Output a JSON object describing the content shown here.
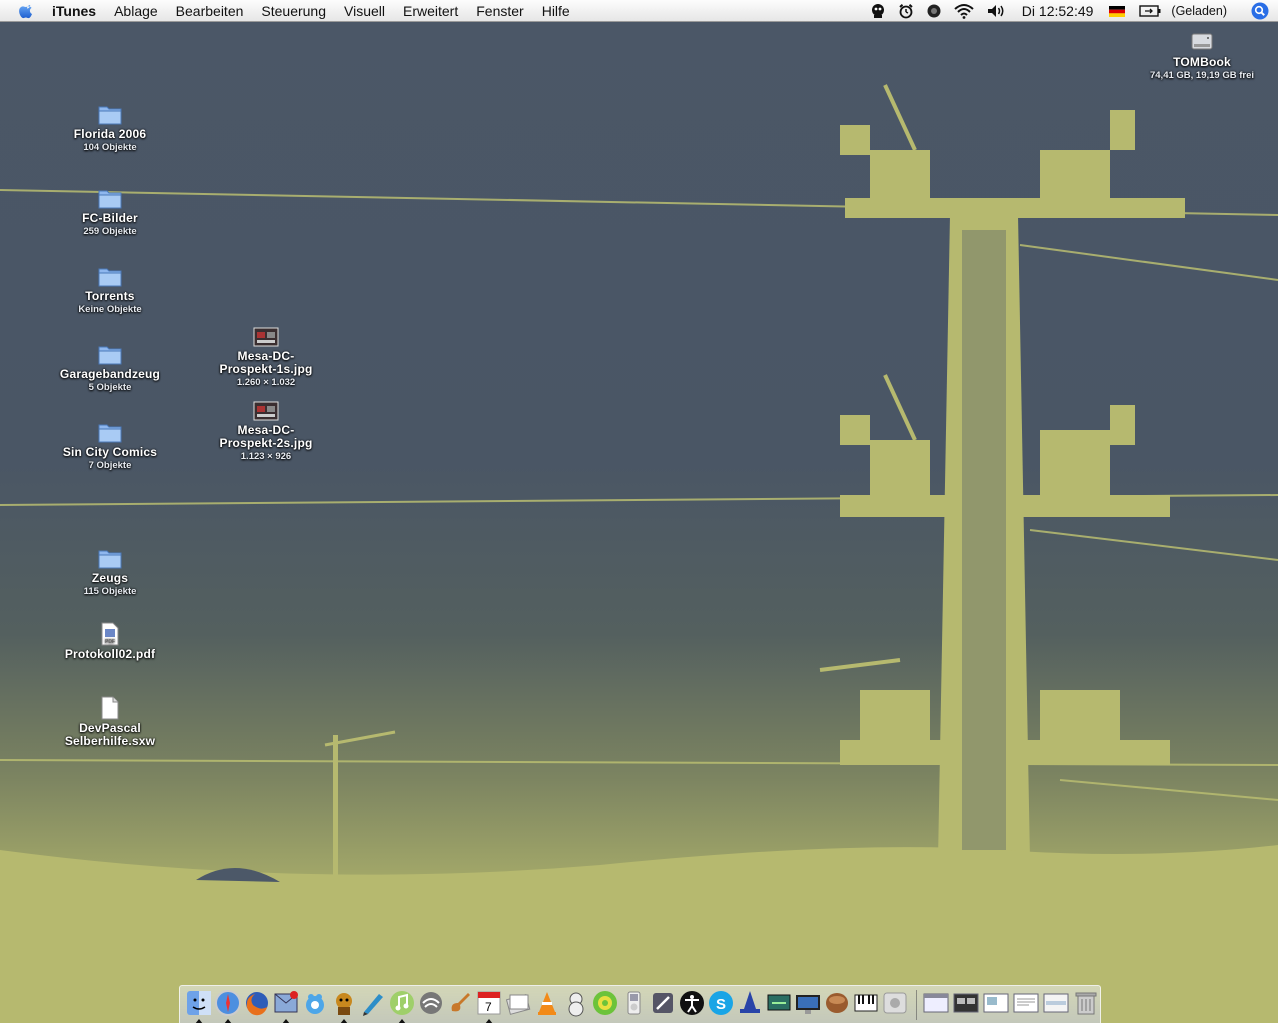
{
  "menubar": {
    "app_name": "iTunes",
    "items": [
      "Ablage",
      "Bearbeiten",
      "Steuerung",
      "Visuell",
      "Erweitert",
      "Fenster",
      "Hilfe"
    ],
    "clock": "Di 12:52:49",
    "battery_status": "(Geladen)",
    "status_icons": [
      "script-icon",
      "alarm-icon",
      "record-icon",
      "wifi-icon",
      "volume-icon",
      "german-flag-icon",
      "battery-icon",
      "spotlight-icon"
    ]
  },
  "desktop": {
    "drive": {
      "name": "TOMBook",
      "info": "74,41 GB, 19,19 GB frei"
    },
    "icons": [
      {
        "name": "Florida 2006",
        "info": "104 Objekte",
        "kind": "folder"
      },
      {
        "name": "FC-Bilder",
        "info": "259 Objekte",
        "kind": "folder"
      },
      {
        "name": "Torrents",
        "info": "Keine Objekte",
        "kind": "folder"
      },
      {
        "name": "Garagebandzeug",
        "info": "5 Objekte",
        "kind": "folder"
      },
      {
        "name": "Sin City Comics",
        "info": "7 Objekte",
        "kind": "folder"
      },
      {
        "name": "Mesa-DC-Prospekt-1s.jpg",
        "name_line1": "Mesa-DC-",
        "name_line2": "Prospekt-1s.jpg",
        "info": "1.260 × 1.032",
        "kind": "image"
      },
      {
        "name": "Mesa-DC-Prospekt-2s.jpg",
        "name_line1": "Mesa-DC-",
        "name_line2": "Prospekt-2s.jpg",
        "info": "1.123 × 926",
        "kind": "image"
      },
      {
        "name": "Zeugs",
        "info": "115 Objekte",
        "kind": "folder"
      },
      {
        "name": "Protokoll02.pdf",
        "info": "",
        "kind": "pdf"
      },
      {
        "name": "DevPascal Selberhilfe.sxw",
        "name_line1": "DevPascal",
        "name_line2": "Selberhilfe.sxw",
        "info": "",
        "kind": "document"
      }
    ]
  },
  "dock": {
    "apps": [
      "finder-icon",
      "safari-icon",
      "firefox-icon",
      "mail-icon",
      "adium-icon",
      "growl-icon",
      "pen-icon",
      "itunes-icon",
      "network-icon",
      "garageband-icon",
      "ical-icon",
      "preview-icon",
      "vlc-icon",
      "app-icon",
      "chess-icon",
      "ipod-icon",
      "pen-tool-icon",
      "accessibility-icon",
      "skype-icon",
      "wizard-icon",
      "screen-icon",
      "system-monitor-icon",
      "bowl-icon",
      "piano-icon",
      "apple-icon"
    ],
    "windows": [
      "window-1-icon",
      "window-2-icon",
      "window-3-icon",
      "window-4-icon",
      "window-5-icon",
      "trash-icon"
    ],
    "running_indicators": [
      "finder-icon",
      "safari-icon",
      "mail-icon",
      "growl-icon",
      "itunes-icon",
      "ical-icon"
    ]
  },
  "colors": {
    "sky": "#4b5767",
    "pylon": "#b6b96f",
    "menubar": "#eeeeee",
    "spotlight": "#2a6ee6"
  }
}
